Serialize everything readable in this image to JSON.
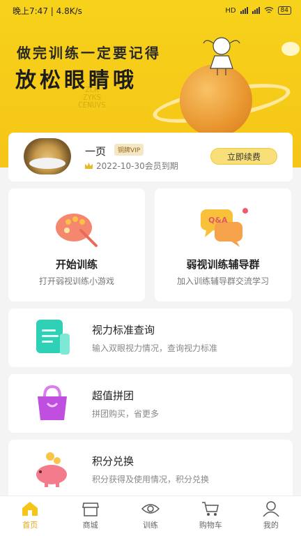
{
  "status_bar": {
    "time": "晚上7:47 | 4.8K/s",
    "network": "HD",
    "battery": "84"
  },
  "hero": {
    "line1": "做完训练一定要记得",
    "line2": "放松眼睛哦",
    "eye_chart": [
      "E",
      "ZCK",
      "ZYKS",
      "CENUVS"
    ]
  },
  "member": {
    "name": "一页",
    "vip_badge": "铜牌VIP",
    "expiry": "2022-10-30会员到期",
    "renew_button": "立即续费"
  },
  "features": [
    {
      "title": "开始训练",
      "subtitle": "打开弱视训练小游戏",
      "icon": "palette-icon"
    },
    {
      "title": "弱视训练辅导群",
      "subtitle": "加入训练辅导群交流学习",
      "icon": "chat-bubbles-icon",
      "icon_text": "Q&A"
    }
  ],
  "list": [
    {
      "title": "视力标准查询",
      "subtitle": "输入双眼视力情况，查询视力标准",
      "icon": "document-icon"
    },
    {
      "title": "超值拼团",
      "subtitle": "拼团购买，省更多",
      "icon": "shopping-bag-icon"
    },
    {
      "title": "积分兑换",
      "subtitle": "积分获得及使用情况，积分兑换",
      "icon": "piggy-bank-icon"
    }
  ],
  "tabs": [
    {
      "label": "首页",
      "icon": "home-icon",
      "active": true
    },
    {
      "label": "商城",
      "icon": "store-icon",
      "active": false
    },
    {
      "label": "训练",
      "icon": "eye-icon",
      "active": false
    },
    {
      "label": "购物车",
      "icon": "cart-icon",
      "active": false
    },
    {
      "label": "我的",
      "icon": "user-icon",
      "active": false
    }
  ],
  "colors": {
    "accent": "#f5c518",
    "tab_active": "#e9a612"
  }
}
